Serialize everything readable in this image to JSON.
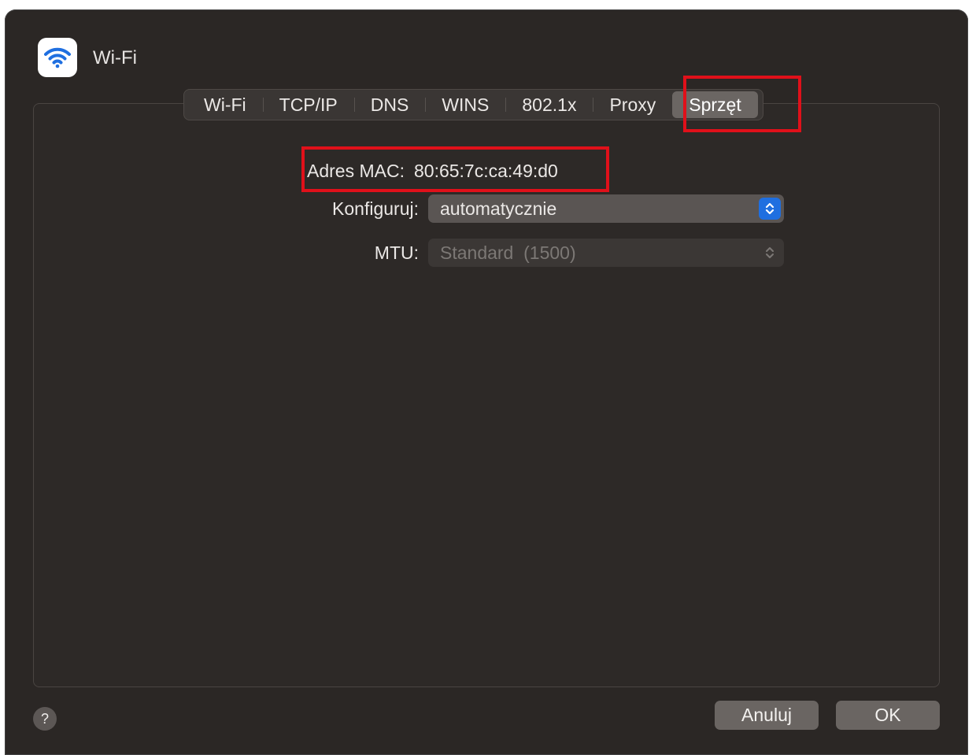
{
  "window": {
    "title": "Wi-Fi",
    "icon": "wifi-icon",
    "accent_color": "#1f6fe0",
    "highlight_color": "#e0101a"
  },
  "tabs": [
    {
      "label": "Wi-Fi",
      "active": false
    },
    {
      "label": "TCP/IP",
      "active": false
    },
    {
      "label": "DNS",
      "active": false
    },
    {
      "label": "WINS",
      "active": false
    },
    {
      "label": "802.1x",
      "active": false
    },
    {
      "label": "Proxy",
      "active": false
    },
    {
      "label": "Sprzęt",
      "active": true
    }
  ],
  "hardware": {
    "mac_label": "Adres MAC:",
    "mac_value": "80:65:7c:ca:49:d0",
    "configure_label": "Konfiguruj:",
    "configure_value": "automatycznie",
    "mtu_label": "MTU:",
    "mtu_value": "Standard  (1500)"
  },
  "footer": {
    "help_label": "?",
    "cancel_label": "Anuluj",
    "ok_label": "OK"
  }
}
